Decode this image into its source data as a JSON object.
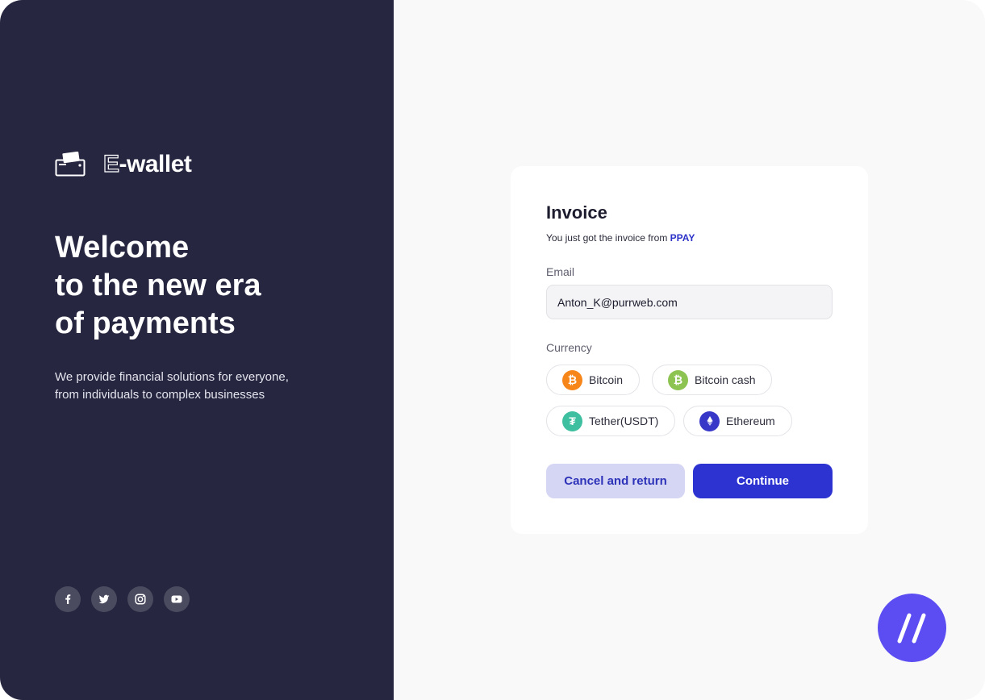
{
  "brand": {
    "name_outlined": "E",
    "name_rest": "-wallet",
    "icon": "wallet-icon"
  },
  "hero": {
    "title_lines": [
      "Welcome",
      "to the new era",
      "of payments"
    ],
    "subtitle_lines": [
      "We provide financial solutions for everyone,",
      "from individuals to complex businesses"
    ]
  },
  "socials": [
    {
      "icon": "facebook-icon"
    },
    {
      "icon": "twitter-icon"
    },
    {
      "icon": "instagram-icon"
    },
    {
      "icon": "youtube-icon"
    }
  ],
  "invoice": {
    "title": "Invoice",
    "subtitle_prefix": "You just got the invoice from ",
    "subtitle_sender": "PPAY",
    "email_label": "Email",
    "email_value": "Anton_K@purrweb.com",
    "currency_label": "Currency",
    "currencies": [
      {
        "label": "Bitcoin",
        "icon": "bitcoin-icon",
        "color": "#f7861a",
        "glyph": "₿"
      },
      {
        "label": "Bitcoin cash",
        "icon": "bitcoin-cash-icon",
        "color": "#8dc351",
        "glyph": "₿"
      },
      {
        "label": "Tether(USDT)",
        "icon": "tether-icon",
        "color": "#3dbfa0",
        "glyph": "₮"
      },
      {
        "label": "Ethereum",
        "icon": "ethereum-icon",
        "color": "#3738c8",
        "glyph": "◆"
      }
    ],
    "cancel_label": "Cancel and return",
    "continue_label": "Continue"
  },
  "colors": {
    "panel": "#262640",
    "accent": "#2d33d1",
    "accent_soft": "#d5d5f4",
    "badge": "#5b4df2"
  },
  "corner_badge": {
    "icon": "double-slash-logo-icon"
  }
}
